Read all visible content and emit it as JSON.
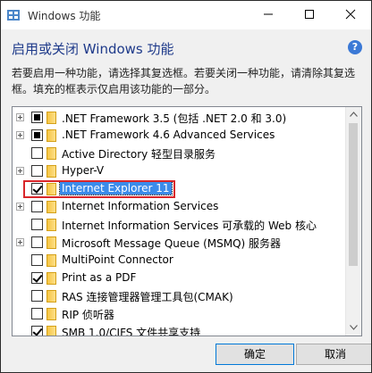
{
  "window": {
    "title": "Windows 功能"
  },
  "heading": "启用或关闭 Windows 功能",
  "description": {
    "line1": "若要启用一种功能，请选择其复选框。若要关闭一种功能，请清除其复选",
    "line2": "框。填充的框表示仅启用该功能的一部分。"
  },
  "features": [
    {
      "label": ".NET Framework 3.5 (包括 .NET 2.0 和 3.0)",
      "expandable": true,
      "state": "partial"
    },
    {
      "label": ".NET Framework 4.6 Advanced Services",
      "expandable": true,
      "state": "partial"
    },
    {
      "label": "Active Directory 轻型目录服务",
      "expandable": false,
      "state": "unchecked"
    },
    {
      "label": "Hyper-V",
      "expandable": true,
      "state": "unchecked"
    },
    {
      "label": "Internet Explorer 11",
      "expandable": false,
      "state": "checked",
      "selected": true
    },
    {
      "label": "Internet Information Services",
      "expandable": true,
      "state": "unchecked"
    },
    {
      "label": "Internet Information Services 可承载的 Web 核心",
      "expandable": false,
      "state": "unchecked"
    },
    {
      "label": "Microsoft Message Queue (MSMQ) 服务器",
      "expandable": true,
      "state": "unchecked"
    },
    {
      "label": "MultiPoint Connector",
      "expandable": false,
      "state": "unchecked"
    },
    {
      "label": "Print as a PDF",
      "expandable": false,
      "state": "checked"
    },
    {
      "label": "RAS 连接管理器管理工具包(CMAK)",
      "expandable": false,
      "state": "unchecked"
    },
    {
      "label": "RIP 侦听器",
      "expandable": false,
      "state": "unchecked"
    },
    {
      "label": "SMB 1.0/CIFS 文件共享支持",
      "expandable": false,
      "state": "checked"
    }
  ],
  "buttons": {
    "ok": "确定",
    "cancel": "取消"
  },
  "colors": {
    "selection": "#3b8bea",
    "highlight_border": "#d9262a",
    "heading": "#1e3a8a",
    "help": "#3b79d6"
  },
  "icons": {
    "app": "windows-features-icon",
    "help": "help-icon",
    "folder": "folder-icon"
  }
}
